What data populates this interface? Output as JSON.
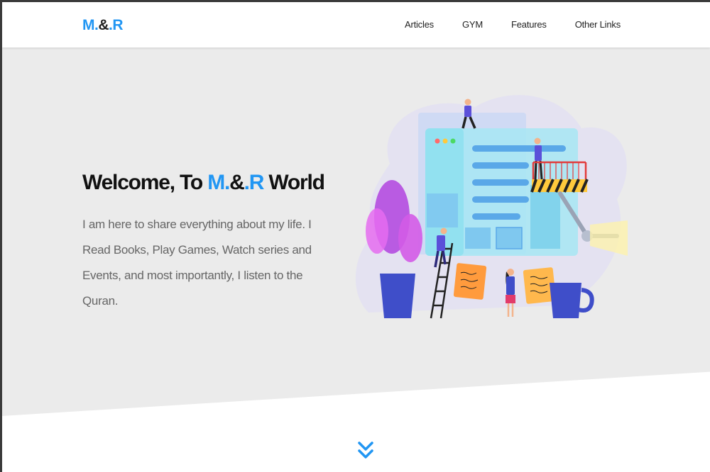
{
  "header": {
    "logo": {
      "part1": "M.",
      "part2": "&",
      "part3": ".R"
    },
    "nav": [
      "Articles",
      "GYM",
      "Features",
      "Other Links"
    ]
  },
  "hero": {
    "title_prefix": "Welcome, To ",
    "title_brand_1": "M.",
    "title_brand_2": "&",
    "title_brand_3": ".R",
    "title_suffix": " World",
    "description": "I am here to share everything about my life. I Read Books, Play Games, Watch series and Events, and most importantly, I listen to the Quran."
  },
  "colors": {
    "accent": "#2196f3",
    "hero_bg": "#ebebeb",
    "text_dark": "#111111",
    "text_muted": "#666666"
  },
  "icons": {
    "scroll": "double-chevron-down-icon"
  }
}
